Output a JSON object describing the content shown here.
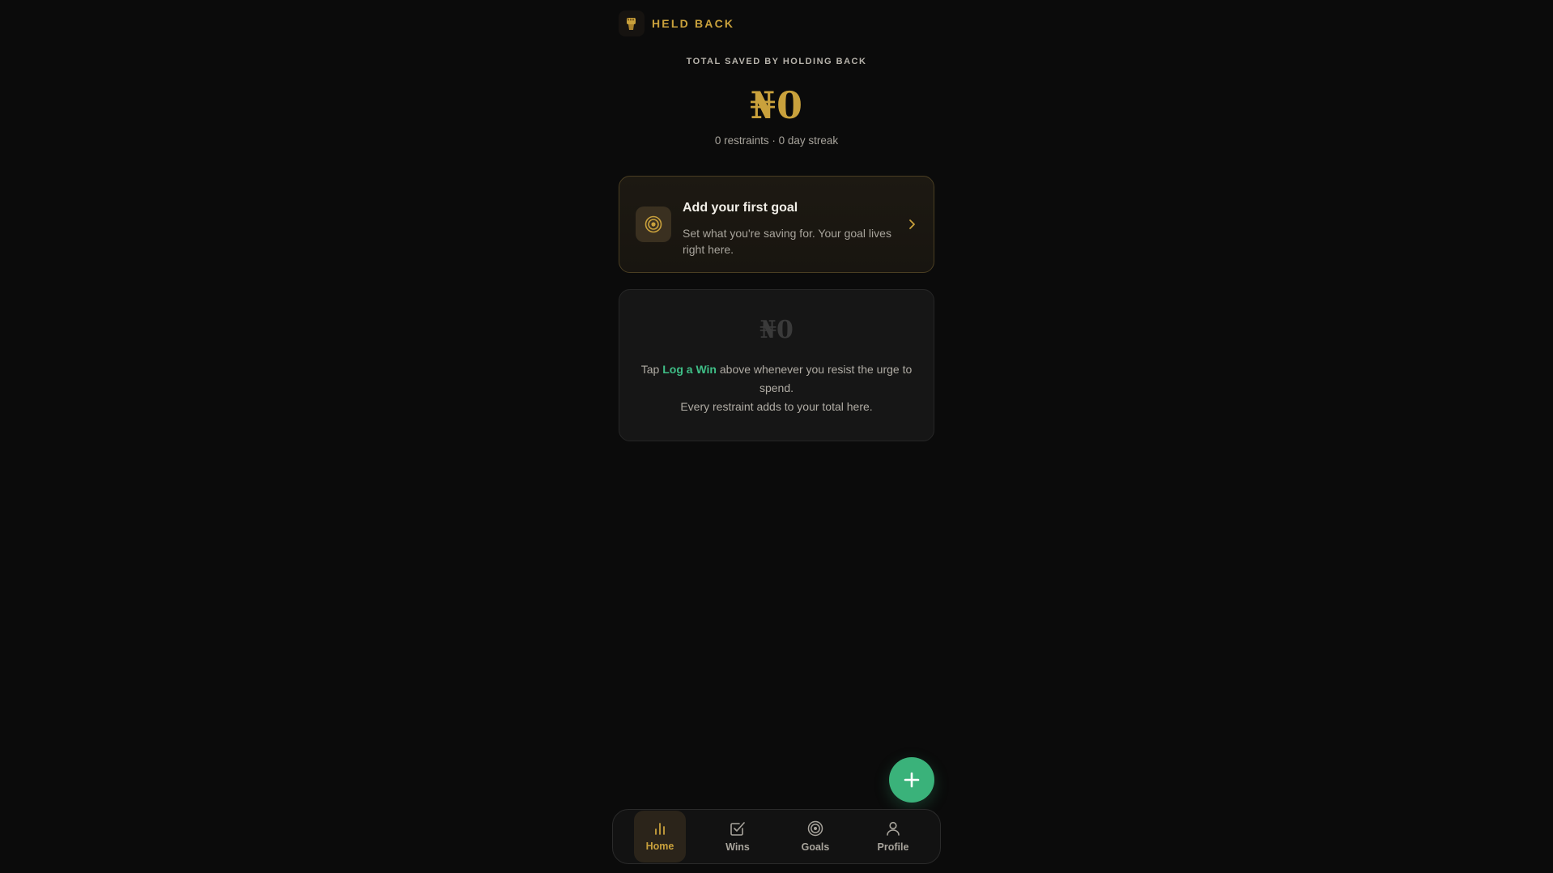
{
  "header": {
    "brand": "HELD BACK",
    "logo_icon": "fist-icon"
  },
  "hero": {
    "label": "TOTAL SAVED BY HOLDING BACK",
    "amount": "₦0",
    "subtitle": "0 restraints · 0 day streak"
  },
  "goal_card": {
    "title": "Add your first goal",
    "description": "Set what you're saving for. Your goal lives right here.",
    "icon": "target-icon"
  },
  "empty_state": {
    "logo": "₦0",
    "text_before": "Tap ",
    "text_highlight": "Log a Win",
    "text_after": " above whenever you resist the urge to spend.",
    "text_line2": "Every restraint adds to your total here."
  },
  "fab": {
    "icon": "plus-icon"
  },
  "nav": {
    "items": [
      {
        "label": "Home",
        "icon": "bar-chart-icon",
        "active": true
      },
      {
        "label": "Wins",
        "icon": "check-square-icon",
        "active": false
      },
      {
        "label": "Goals",
        "icon": "target-icon",
        "active": false
      },
      {
        "label": "Profile",
        "icon": "user-icon",
        "active": false
      }
    ]
  },
  "colors": {
    "background": "#0b0b0b",
    "gold": "#c9a13c",
    "green": "#3ab27a",
    "text_muted": "#a8a49c"
  }
}
